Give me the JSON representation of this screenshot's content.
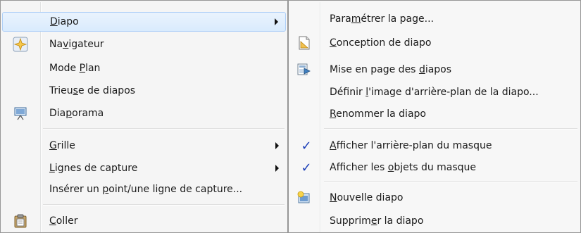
{
  "main_menu": {
    "items": [
      {
        "pre": "",
        "u": "D",
        "post": "iapo",
        "submenu": true,
        "highlight": true,
        "icon": ""
      },
      {
        "pre": "Na",
        "u": "v",
        "post": "igateur",
        "submenu": false,
        "icon": "navigator-icon"
      },
      {
        "pre": "Mode ",
        "u": "P",
        "post": "lan",
        "submenu": false,
        "icon": ""
      },
      {
        "pre": "Trieu",
        "u": "s",
        "post": "e de diapos",
        "submenu": false,
        "icon": ""
      },
      {
        "pre": "Dia",
        "u": "p",
        "post": "orama",
        "submenu": false,
        "icon": "slideshow-icon"
      },
      {
        "pre": "",
        "u": "G",
        "post": "rille",
        "submenu": true,
        "icon": ""
      },
      {
        "pre": "",
        "u": "L",
        "post": "ignes de capture",
        "submenu": true,
        "icon": ""
      },
      {
        "pre": "Insérer un ",
        "u": "p",
        "post": "oint/une ligne de capture...",
        "submenu": false,
        "icon": ""
      },
      {
        "pre": "",
        "u": "C",
        "post": "oller",
        "submenu": false,
        "icon": "paste-icon"
      }
    ]
  },
  "sub_menu": {
    "items": [
      {
        "pre": "Para",
        "u": "m",
        "post": "étrer la page...",
        "icon": ""
      },
      {
        "pre": "",
        "u": "C",
        "post": "onception de diapo",
        "icon": "slide-design-icon"
      },
      {
        "pre": "Mise en page des ",
        "u": "d",
        "post": "iapos",
        "icon": "slide-layout-icon"
      },
      {
        "pre": "Définir ",
        "u": "l",
        "post": "'image d'arrière-plan de la diapo...",
        "icon": ""
      },
      {
        "pre": "",
        "u": "R",
        "post": "enommer la diapo",
        "icon": ""
      },
      {
        "pre": "",
        "u": "A",
        "post": "fficher l'arrière-plan du masque",
        "checked": true,
        "icon": "check-icon"
      },
      {
        "pre": "Afficher les ",
        "u": "o",
        "post": "bjets du masque",
        "checked": true,
        "icon": "check-icon"
      },
      {
        "pre": "",
        "u": "N",
        "post": "ouvelle diapo",
        "icon": "new-slide-icon"
      },
      {
        "pre": "Supprim",
        "u": "e",
        "post": "r la diapo",
        "icon": ""
      }
    ]
  },
  "colors": {
    "check": "#1c3fb8",
    "highlight_border": "#aecff7"
  }
}
